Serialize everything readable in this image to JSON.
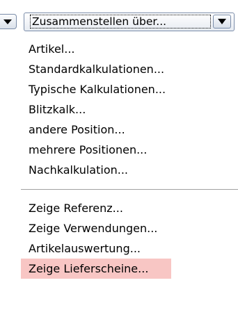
{
  "toolbar": {
    "dropdown_value": "Zusammenstellen über..."
  },
  "menu": {
    "group1": [
      "Artikel...",
      "Standardkalkulationen...",
      "Typische Kalkulationen...",
      "Blitzkalk...",
      "andere Position...",
      "mehrere Positionen...",
      "Nachkalkulation..."
    ],
    "group2": [
      "Zeige Referenz...",
      "Zeige Verwendungen...",
      "Artikelauswertung...",
      "Zeige Lieferscheine..."
    ]
  },
  "icons": {
    "left_button": "chevron-down-icon",
    "dropdown_button": "chevron-down-icon"
  },
  "colors": {
    "highlight": "#f8c6c4",
    "separator": "#a0a0a0"
  }
}
